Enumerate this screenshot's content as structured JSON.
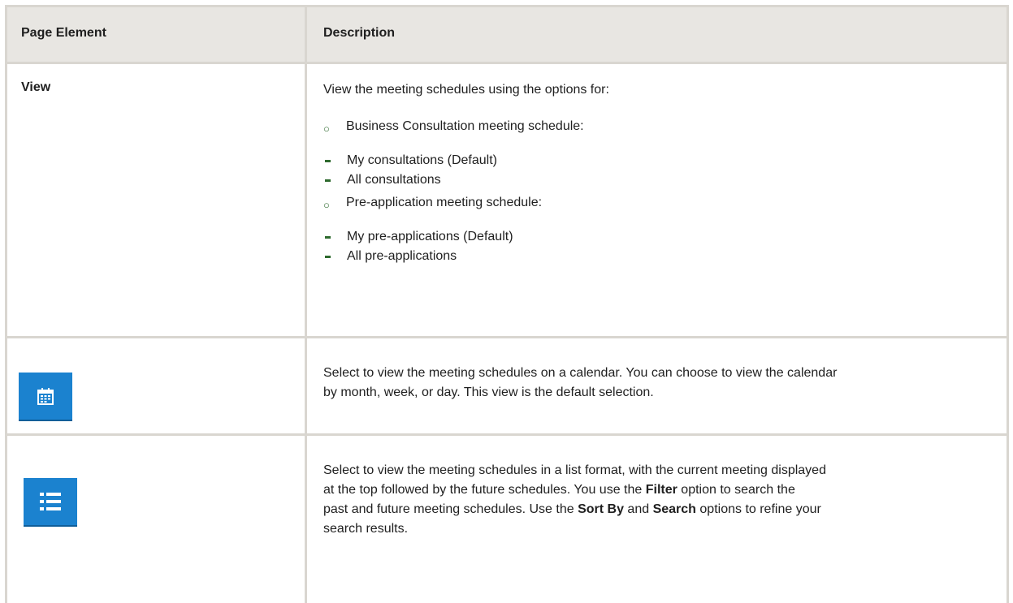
{
  "table": {
    "header": {
      "col1": "Page Element",
      "col2": "Description"
    },
    "rows": {
      "view": {
        "element": "View",
        "intro": "View the meeting schedules using the options for:",
        "groups": [
          {
            "label": "Business Consultation meeting schedule:",
            "items": [
              "My consultations (Default)",
              "All consultations"
            ]
          },
          {
            "label": "Pre-application meeting schedule:",
            "items": [
              "My pre-applications (Default)",
              "All pre-applications"
            ]
          }
        ]
      },
      "calendar": {
        "icon": "calendar-icon",
        "line1": "Select to view the meeting schedules on a calendar. You can choose to view the calendar",
        "line2": "by month, week, or day. This view is the default selection."
      },
      "list": {
        "icon": "list-icon",
        "line1": "Select to view the meeting schedules in a list format, with the current meeting displayed",
        "line2a": "at the top followed by the future schedules. You use the ",
        "filter": "Filter",
        "line2b": " option to search the",
        "line3a": "past and future meeting schedules. Use the ",
        "sort_by": "Sort By",
        "line3b": " and ",
        "search": "Search",
        "line3c": " options to refine your",
        "line4": "search results."
      }
    }
  },
  "colors": {
    "border": "#d9d6d0",
    "header_bg": "#e8e6e2",
    "icon_bg": "#1b82cf",
    "bullet": "#2e6a2e"
  }
}
